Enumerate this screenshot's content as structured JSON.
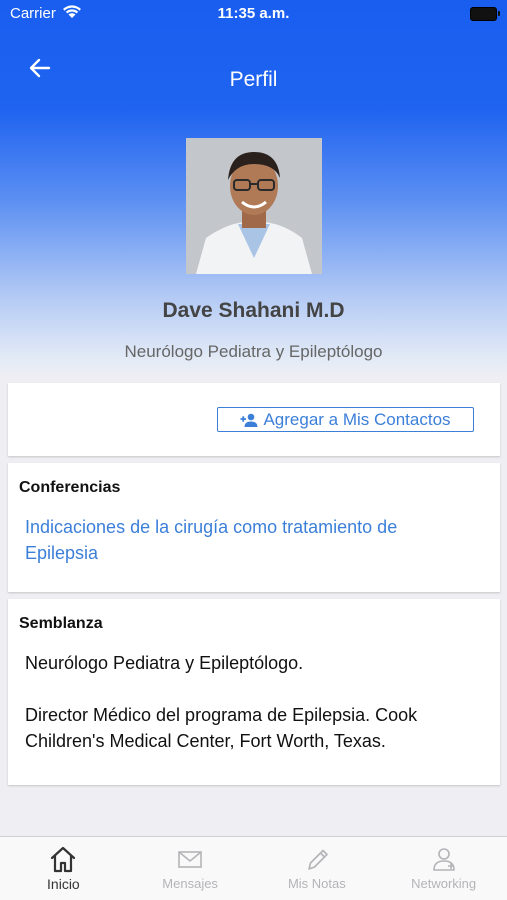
{
  "status_bar": {
    "carrier": "Carrier",
    "time": "11:35 a.m."
  },
  "nav": {
    "title": "Perfil",
    "back_icon": "arrow-left-icon"
  },
  "profile": {
    "name": "Dave Shahani M.D",
    "specialty": "Neurólogo Pediatra y Epileptólogo"
  },
  "actions": {
    "add_contact_label": "Agregar a Mis Contactos",
    "add_contact_icon": "add-person-icon"
  },
  "conferences": {
    "title": "Conferencias",
    "items": [
      "Indicaciones de la cirugía como tratamiento de Epilepsia"
    ]
  },
  "bio": {
    "title": "Semblanza",
    "text": "Neurólogo Pediatra y Epileptólogo.\n\nDirector Médico del programa de Epilepsia.  Cook Children's Medical Center,  Fort Worth, Texas."
  },
  "tabs": [
    {
      "label": "Inicio",
      "icon": "home-icon",
      "active": true
    },
    {
      "label": "Mensajes",
      "icon": "mail-icon",
      "active": false
    },
    {
      "label": "Mis Notas",
      "icon": "pencil-icon",
      "active": false
    },
    {
      "label": "Networking",
      "icon": "people-icon",
      "active": false
    }
  ],
  "colors": {
    "header_blue": "#1a5ef0",
    "link_blue": "#3c7fd9"
  }
}
